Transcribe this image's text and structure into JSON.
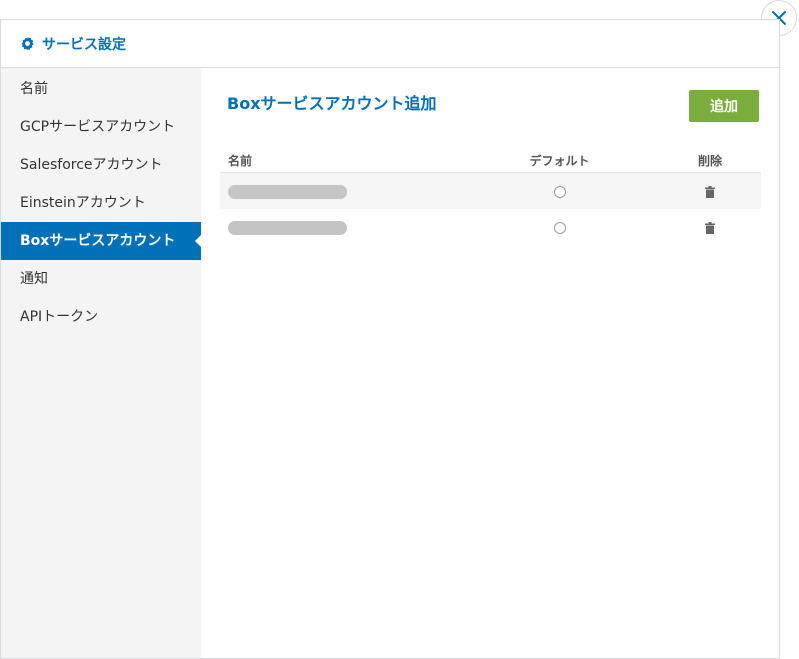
{
  "modal": {
    "title": "サービス設定",
    "close_icon": "close-icon",
    "settings_icon": "gear-icon"
  },
  "sidebar": {
    "items": [
      {
        "label": "名前",
        "active": false
      },
      {
        "label": "GCPサービスアカウント",
        "active": false
      },
      {
        "label": "Salesforceアカウント",
        "active": false
      },
      {
        "label": "Einsteinアカウント",
        "active": false
      },
      {
        "label": "Boxサービスアカウント",
        "active": true
      },
      {
        "label": "通知",
        "active": false
      },
      {
        "label": "APIトークン",
        "active": false
      }
    ]
  },
  "main": {
    "title": "Boxサービスアカウント追加",
    "add_label": "追加",
    "table": {
      "headers": [
        "名前",
        "デフォルト",
        "削除"
      ],
      "rows": [
        {
          "name": "",
          "default": false
        },
        {
          "name": "",
          "default": false
        }
      ]
    }
  },
  "colors": {
    "accent": "#0070b8",
    "add_button": "#7aad3c",
    "sidebar_bg": "#f4f4f4"
  }
}
